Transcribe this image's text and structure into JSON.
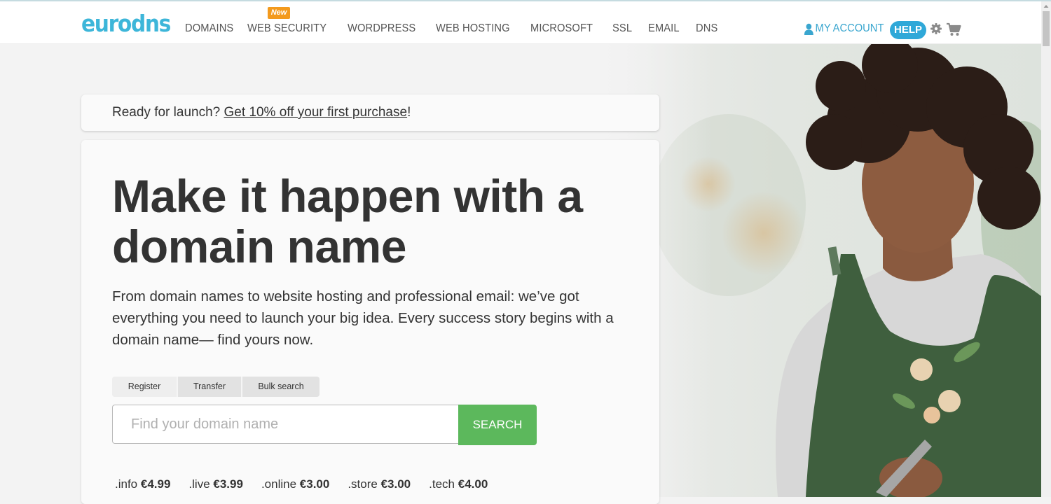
{
  "header": {
    "logo": "eurodns",
    "nav": [
      {
        "label": "DOMAINS"
      },
      {
        "label": "WEB SECURITY",
        "badge": "New"
      },
      {
        "label": "WORDPRESS"
      },
      {
        "label": "WEB HOSTING"
      },
      {
        "label": "MICROSOFT"
      },
      {
        "label": "SSL"
      },
      {
        "label": "EMAIL"
      },
      {
        "label": "DNS"
      }
    ],
    "account_label": "MY ACCOUNT",
    "help_label": "HELP",
    "icons": [
      "user-icon",
      "gear-icon",
      "cart-icon"
    ]
  },
  "promo": {
    "prefix": "Ready for launch? ",
    "link": "Get 10% off your first purchase",
    "suffix": "!"
  },
  "hero": {
    "headline": "Make it happen with a domain name",
    "subtext": "From domain names to website hosting and professional email: we’ve got everything you need to launch your big idea. Every success story begins with a domain name— find yours now."
  },
  "search": {
    "tabs": [
      "Register",
      "Transfer",
      "Bulk search"
    ],
    "placeholder": "Find your domain name",
    "button": "SEARCH"
  },
  "prices": [
    {
      "tld": ".info",
      "price": "€4.99"
    },
    {
      "tld": ".live",
      "price": "€3.99"
    },
    {
      "tld": ".online",
      "price": "€3.00"
    },
    {
      "tld": ".store",
      "price": "€3.00"
    },
    {
      "tld": ".tech",
      "price": "€4.00"
    }
  ],
  "colors": {
    "brand": "#3db6d9",
    "nav_text": "#555555",
    "badge": "#f39a1d",
    "help": "#2fa8d8",
    "search_button": "#5cb85c",
    "heading": "#333333"
  }
}
